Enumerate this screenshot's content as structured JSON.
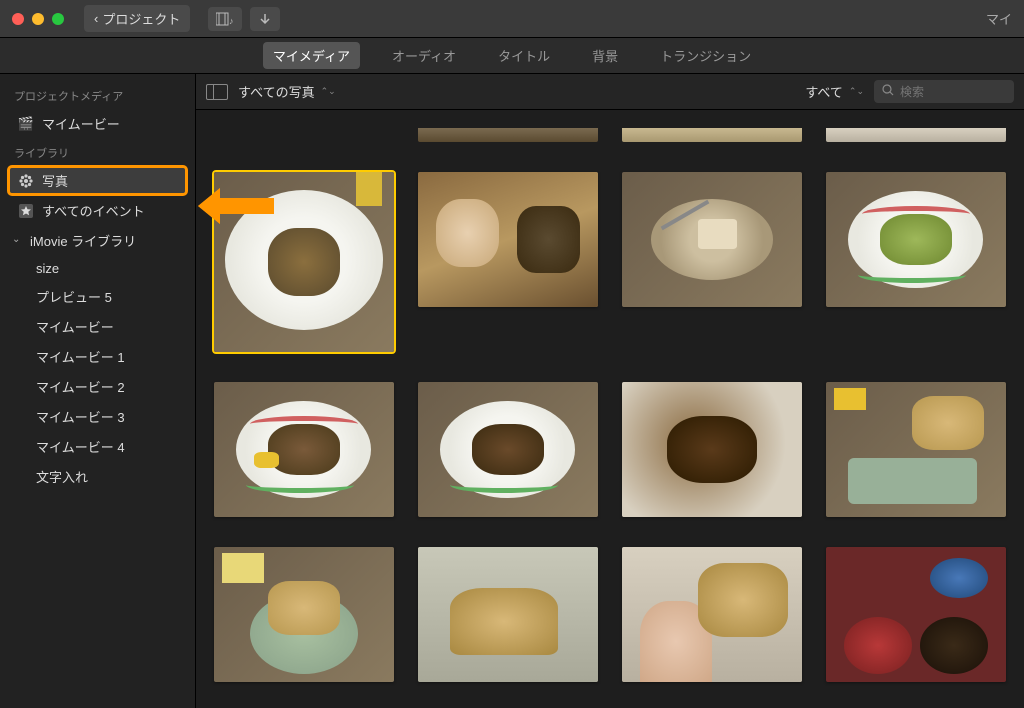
{
  "titlebar": {
    "back": "プロジェクト",
    "right": "マイ"
  },
  "tabs": {
    "media": "マイメディア",
    "audio": "オーディオ",
    "titles": "タイトル",
    "backgrounds": "背景",
    "transitions": "トランジション"
  },
  "sidebar": {
    "section_project": "プロジェクトメディア",
    "my_movie": "マイムービー",
    "section_library": "ライブラリ",
    "photos": "写真",
    "all_events": "すべてのイベント",
    "imovie_lib": "iMovie ライブラリ",
    "children": [
      "size",
      "プレビュー 5",
      "マイムービー",
      "マイムービー 1",
      "マイムービー 2",
      "マイムービー 3",
      "マイムービー 4",
      "文字入れ"
    ]
  },
  "filterbar": {
    "source": "すべての写真",
    "scope": "すべて",
    "search_placeholder": "検索"
  }
}
